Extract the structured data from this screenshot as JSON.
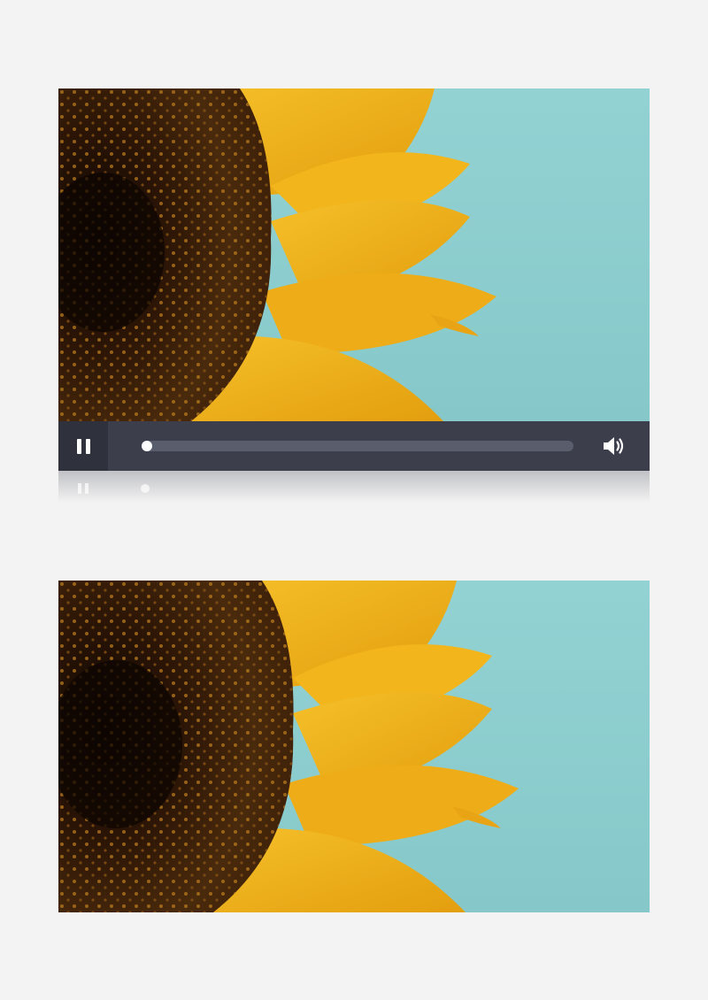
{
  "player": {
    "state": "playing",
    "play_pause_icon": "pause-icon",
    "volume_icon": "volume-icon",
    "progress": 0.0
  },
  "colors": {
    "sky": "#8fcfd0",
    "petal": "#f0b41a",
    "disc": "#2a1608",
    "controls_bg": "#3c3f4b",
    "controls_btn_bg": "#2f323c",
    "track": "#595d6c"
  }
}
